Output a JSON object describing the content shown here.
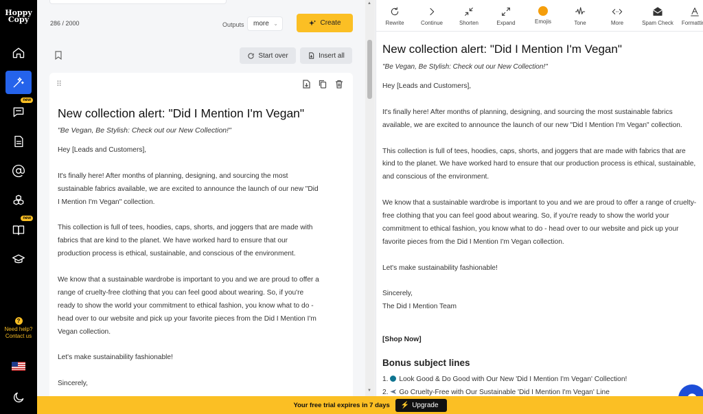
{
  "brand": {
    "line1": "Hoppy",
    "line2": "Copy"
  },
  "sidebar": {
    "badges": {
      "chat": "new",
      "book": "new"
    },
    "help": {
      "line1": "Need help?",
      "line2": "Contact us"
    }
  },
  "editor": {
    "char_count": "286 / 2000",
    "outputs_label": "Outputs",
    "outputs_value": "more",
    "create_label": "Create",
    "start_over_label": "Start over",
    "insert_all_label": "Insert all",
    "card": {
      "title": "New collection alert: \"Did I Mention I'm Vegan\"",
      "subtitle": "\"Be Vegan, Be Stylish: Check out our New Collection!\"",
      "greeting": "Hey [Leads and Customers],",
      "p1": "It's finally here! After months of planning, designing, and sourcing the most sustainable fabrics available, we are excited to announce the launch of our new \"Did I Mention I'm Vegan\" collection.",
      "p2": "This collection is full of tees, hoodies, caps, shorts, and joggers that are made with fabrics that are kind to the planet. We have worked hard to ensure that our production process is ethical, sustainable, and conscious of the environment.",
      "p3": "We know that a sustainable wardrobe is important to you and we are proud to offer a range of cruelty-free clothing that you can feel good about wearing. So, if you're ready to show the world your commitment to ethical fashion, you know what to do - head over to our website and pick up your favorite pieces from the Did I Mention I'm Vegan collection.",
      "p4": "Let's make sustainability fashionable!",
      "p5": "Sincerely,"
    }
  },
  "toolbar": {
    "rewrite": "Rewrite",
    "continue": "Continue",
    "shorten": "Shorten",
    "expand": "Expand",
    "emojis": "Emojis",
    "tone": "Tone",
    "more": "More",
    "spam_check": "Spam Check",
    "formatting": "Formatting"
  },
  "preview": {
    "title": "New collection alert: \"Did I Mention I'm Vegan\"",
    "subtitle": "\"Be Vegan, Be Stylish: Check out our New Collection!\"",
    "greeting": "Hey [Leads and Customers],",
    "p1": "It's finally here! After months of planning, designing, and sourcing the most sustainable fabrics available, we are excited to announce the launch of our new \"Did I Mention I'm Vegan\" collection.",
    "p2": "This collection is full of tees, hoodies, caps, shorts, and joggers that are made with fabrics that are kind to the planet. We have worked hard to ensure that our production process is ethical, sustainable, and conscious of the environment.",
    "p3": "We know that a sustainable wardrobe is important to you and we are proud to offer a range of cruelty-free clothing that you can feel good about wearing. So, if you're ready to show the world your commitment to ethical fashion, you know what to do - head over to our website and pick up your favorite pieces from the Did I Mention I'm Vegan collection.",
    "p4": "Let's make sustainability fashionable!",
    "sign1": "Sincerely,",
    "sign2": "The Did I Mention Team",
    "shop": "[Shop Now]",
    "bonus_title": "Bonus subject lines",
    "bonus1": "Look Good & Do Good with Our New 'Did I Mention I'm Vegan' Collection!",
    "bonus2": "Go Cruelty-Free with Our Sustainable 'Did I Mention I'm Vegan' Line",
    "bonus1_num": "1.",
    "bonus2_num": "2."
  },
  "banner": {
    "trial_text": "Your free trial expires in 7 days",
    "upgrade_label": "Upgrade"
  },
  "colors": {
    "accent": "#fbbf24",
    "active": "#2563eb",
    "sidebar": "#000000"
  }
}
